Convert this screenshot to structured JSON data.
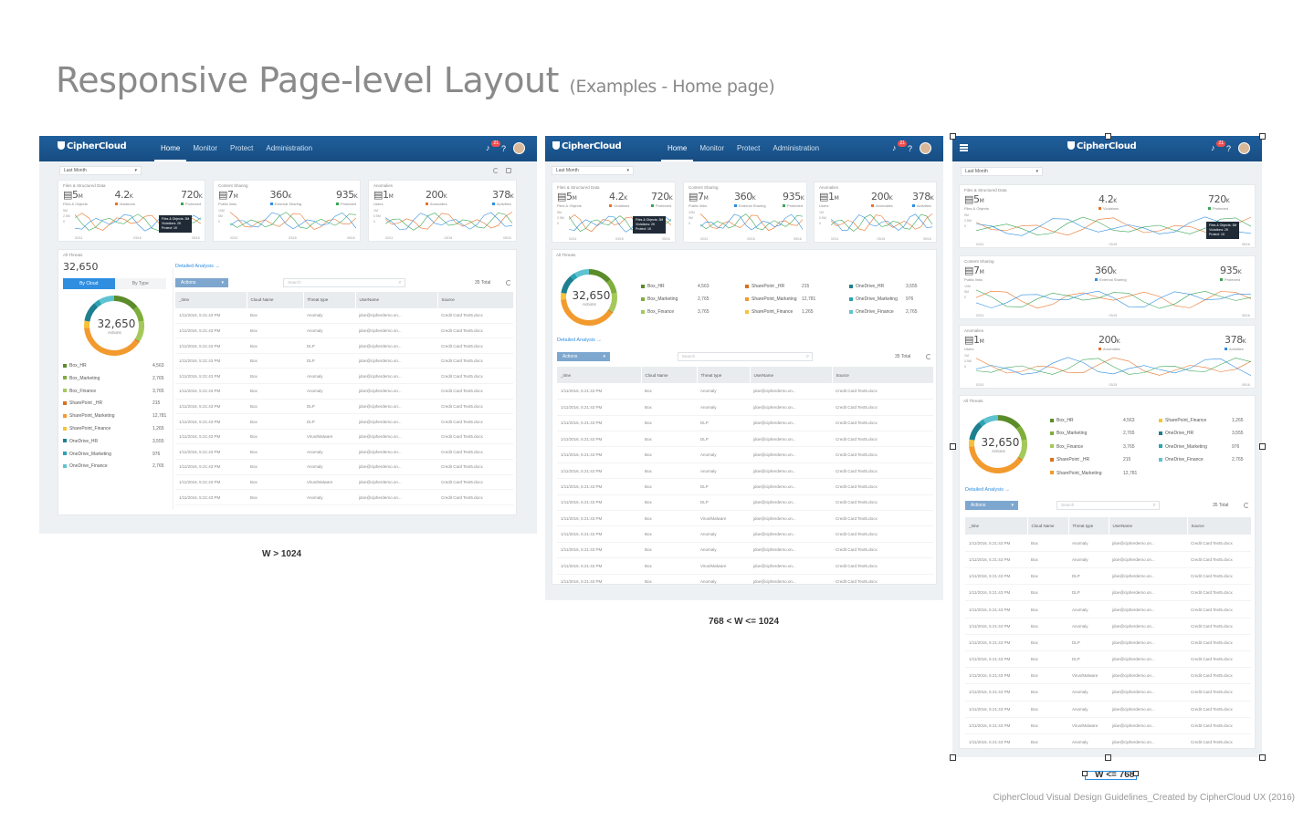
{
  "header": {
    "title": "Responsive Page-level Layout",
    "subtitle": "(Examples - Home page)"
  },
  "footer": "CipherCloud Visual Design Guidelines_Created by CipherCloud UX (2016)",
  "captions": [
    "W > 1024",
    "768 < W <= 1024",
    "W <= 768"
  ],
  "app": {
    "logo": "CipherCloud",
    "nav": [
      "Home",
      "Monitor",
      "Protect",
      "Administration"
    ],
    "notif_count": "21",
    "help": "?",
    "date_range": "Last Month",
    "cards": [
      {
        "label": "Files & Structured Data",
        "icon": "file-icon",
        "stats": [
          {
            "v": "5",
            "u": "M",
            "l": "Files & Objects",
            "c": ""
          },
          {
            "v": "4.2",
            "u": "K",
            "l": "Violations",
            "c": "#e8742a"
          },
          {
            "v": "720",
            "u": "K",
            "l": "Protected",
            "c": "#3aa655"
          }
        ],
        "axis": [
          "5M",
          "2.5M",
          "0"
        ],
        "ticks": [
          "02/11",
          "03/15",
          "05/16"
        ]
      },
      {
        "label": "Content Sharing",
        "icon": "link-icon",
        "stats": [
          {
            "v": "7",
            "u": "M",
            "l": "Public links",
            "c": ""
          },
          {
            "v": "360",
            "u": "K",
            "l": "External Sharing",
            "c": "#2f8ee0"
          },
          {
            "v": "935",
            "u": "K",
            "l": "Protected",
            "c": "#3aa655"
          }
        ],
        "axis": [
          "10M",
          "5M",
          "0"
        ],
        "ticks": [
          "02/11",
          "03/15",
          "05/16"
        ]
      },
      {
        "label": "Anomalies",
        "icon": "users-icon",
        "stats": [
          {
            "v": "1",
            "u": "M",
            "l": "Users",
            "c": ""
          },
          {
            "v": "200",
            "u": "K",
            "l": "Anomalies",
            "c": "#e8742a"
          },
          {
            "v": "378",
            "u": "K",
            "l": "Activities",
            "c": "#2f8ee0"
          }
        ],
        "axis": [
          "1M",
          "0.5M",
          "0"
        ],
        "ticks": [
          "02/11",
          "03/15",
          "05/16"
        ]
      }
    ],
    "tooltip": [
      "Files & Objects: 3M",
      "Violations: 2K",
      "Protect: 1K"
    ],
    "threats": {
      "label": "All Threats",
      "total": "32,650",
      "donut_label": "Actions",
      "toggle": [
        "By Cloud",
        "By Type"
      ],
      "legend": [
        {
          "name": "Box_HR",
          "value": "4,563",
          "color": "#5b8c2a"
        },
        {
          "name": "Box_Marketing",
          "value": "2,765",
          "color": "#7fae3a"
        },
        {
          "name": "Box_Finance",
          "value": "3,765",
          "color": "#a4c95a"
        },
        {
          "name": "SharePoint _HR",
          "value": "215",
          "color": "#d8711e"
        },
        {
          "name": "SharePoint_Marketing",
          "value": "12,781",
          "color": "#f29a2e"
        },
        {
          "name": "SharePoint_Finance",
          "value": "1,265",
          "color": "#f6c23a"
        },
        {
          "name": "OneDrive_HR",
          "value": "3,555",
          "color": "#1d7f8f"
        },
        {
          "name": "OneDrive_Marketing",
          "value": "976",
          "color": "#2ba3b3"
        },
        {
          "name": "OneDrive_Finance",
          "value": "2,765",
          "color": "#5ec2d0"
        }
      ],
      "donut_values": [
        4563,
        2765,
        3765,
        215,
        12781,
        1265,
        3555,
        976,
        2765
      ]
    },
    "analysis_link": "Detailed Analysis",
    "actions": "Actions",
    "search_placeholder": "Search",
    "total": "35 Total",
    "columns": [
      "_time",
      "Cloud Name",
      "Threat type",
      "UserName",
      "Source"
    ],
    "rows": [
      [
        "1/11/2016, 5:21:43 PM",
        "Box",
        "Anomaly",
        "jdoe@cipherdemo.on...",
        "Credit Card Text5.docx"
      ],
      [
        "1/11/2016, 5:21:43 PM",
        "Box",
        "Anomaly",
        "jdoe@cipherdemo.on...",
        "Credit Card Text5.docx"
      ],
      [
        "1/11/2016, 5:21:43 PM",
        "Box",
        "DLP",
        "jdoe@cipherdemo.on...",
        "Credit Card Text5.docx"
      ],
      [
        "1/11/2016, 5:21:43 PM",
        "Box",
        "DLP",
        "jdoe@cipherdemo.on...",
        "Credit Card Text5.docx"
      ],
      [
        "1/11/2016, 5:21:43 PM",
        "Box",
        "Anomaly",
        "jdoe@cipherdemo.on...",
        "Credit Card Text5.docx"
      ],
      [
        "1/11/2016, 5:21:43 PM",
        "Box",
        "Anomaly",
        "jdoe@cipherdemo.on...",
        "Credit Card Text5.docx"
      ],
      [
        "1/11/2016, 5:21:43 PM",
        "Box",
        "DLP",
        "jdoe@cipherdemo.on...",
        "Credit Card Text5.docx"
      ],
      [
        "1/11/2016, 5:21:43 PM",
        "Box",
        "DLP",
        "jdoe@cipherdemo.on...",
        "Credit Card Text5.docx"
      ],
      [
        "1/11/2016, 5:21:43 PM",
        "Box",
        "Virus/Malware",
        "jdoe@cipherdemo.on...",
        "Credit Card Text5.docx"
      ],
      [
        "1/11/2016, 5:21:43 PM",
        "Box",
        "Anomaly",
        "jdoe@cipherdemo.on...",
        "Credit Card Text5.docx"
      ],
      [
        "1/11/2016, 5:21:43 PM",
        "Box",
        "Anomaly",
        "jdoe@cipherdemo.on...",
        "Credit Card Text5.docx"
      ],
      [
        "1/11/2016, 5:21:43 PM",
        "Box",
        "Virus/Malware",
        "jdoe@cipherdemo.on...",
        "Credit Card Text5.docx"
      ],
      [
        "1/11/2016, 5:21:43 PM",
        "Box",
        "Anomaly",
        "jdoe@cipherdemo.on...",
        "Credit Card Text5.docx"
      ]
    ]
  }
}
